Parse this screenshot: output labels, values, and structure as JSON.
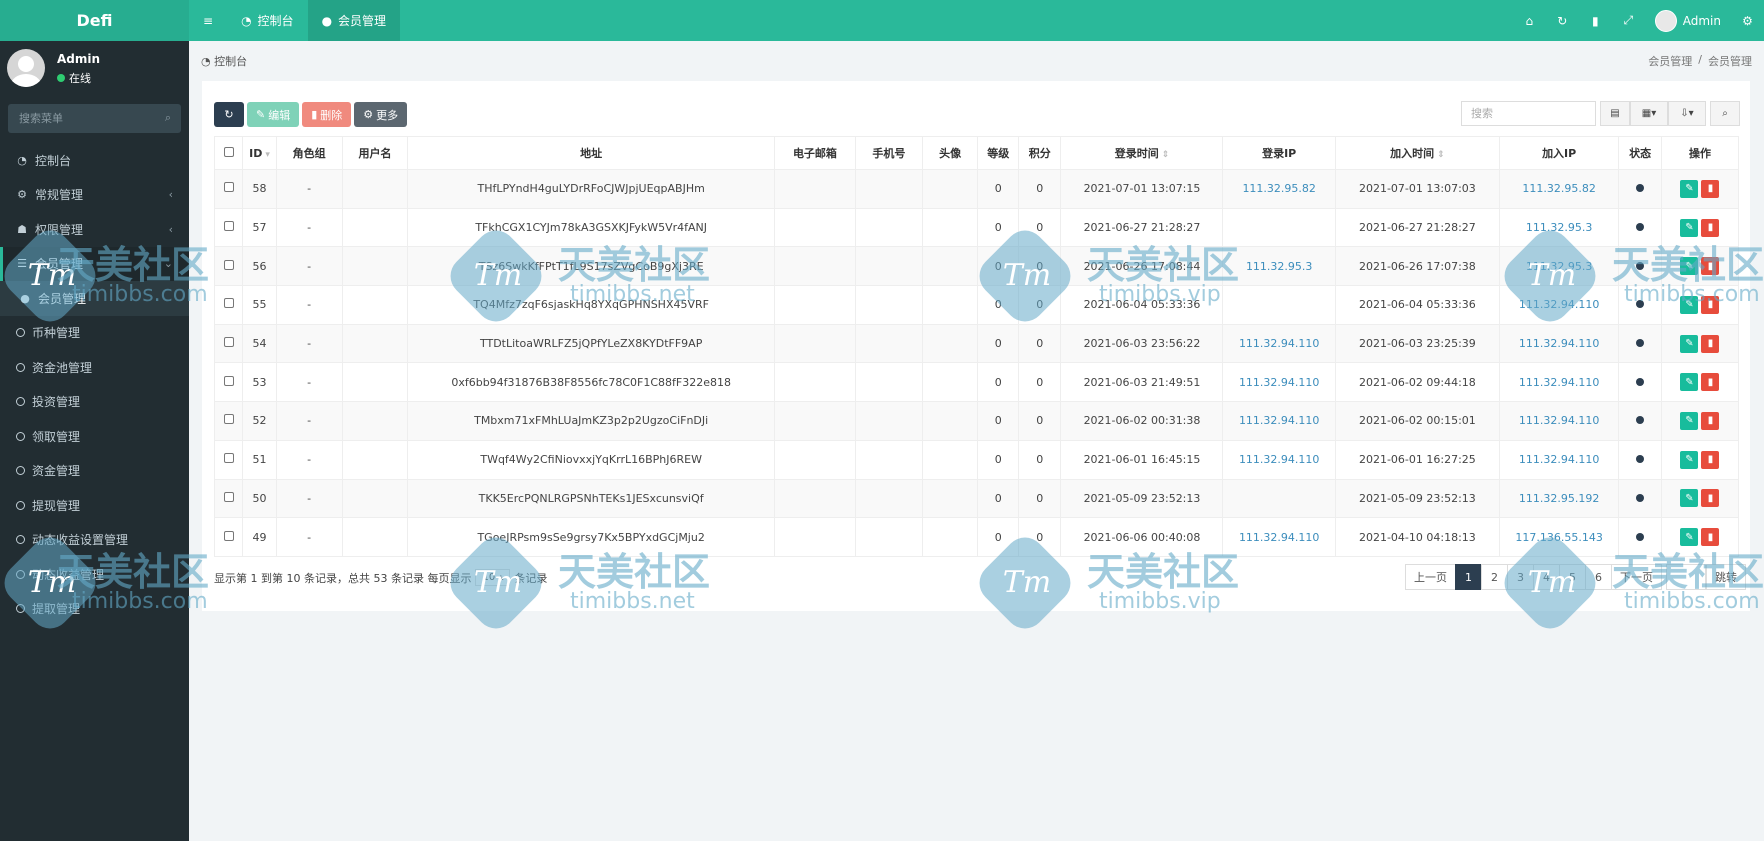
{
  "app": {
    "title": "Defi"
  },
  "topnav": {
    "tabs": [
      {
        "label": "控制台",
        "icon": "dashboard-icon"
      },
      {
        "label": "会员管理",
        "icon": "user-icon"
      }
    ],
    "user": "Admin"
  },
  "sidebar": {
    "user": {
      "name": "Admin",
      "status": "在线"
    },
    "search_placeholder": "搜索菜单",
    "items": [
      {
        "label": "控制台",
        "icon": "dashboard-icon"
      },
      {
        "label": "常规管理",
        "icon": "cogs-icon"
      },
      {
        "label": "权限管理",
        "icon": "group-icon"
      },
      {
        "label": "会员管理",
        "icon": "list-icon"
      },
      {
        "label": "会员管理",
        "icon": "user-icon"
      },
      {
        "label": "币种管理",
        "icon": "circle-icon"
      },
      {
        "label": "资金池管理",
        "icon": "circle-icon"
      },
      {
        "label": "投资管理",
        "icon": "circle-icon"
      },
      {
        "label": "领取管理",
        "icon": "circle-icon"
      },
      {
        "label": "资金管理",
        "icon": "circle-icon"
      },
      {
        "label": "提现管理",
        "icon": "circle-icon"
      },
      {
        "label": "动态收益设置管理",
        "icon": "circle-icon"
      },
      {
        "label": "动态收益管理",
        "icon": "circle-icon"
      },
      {
        "label": "提取管理",
        "icon": "circle-icon"
      }
    ]
  },
  "breadcrumb": {
    "left": "控制台",
    "right": [
      "会员管理",
      "/",
      "会员管理"
    ]
  },
  "toolbar": {
    "edit": "编辑",
    "delete": "删除",
    "more": "更多",
    "search_placeholder": "搜索"
  },
  "table": {
    "headers": [
      "ID",
      "角色组",
      "用户名",
      "地址",
      "电子邮箱",
      "手机号",
      "头像",
      "等级",
      "积分",
      "登录时间",
      "登录IP",
      "加入时间",
      "加入IP",
      "状态",
      "操作"
    ],
    "rows": [
      {
        "id": "58",
        "group": "-",
        "username": "",
        "address": "THfLPYndH4guLYDrRFoCJWJpjUEqpABJHm",
        "email": "",
        "mobile": "",
        "avatar": "",
        "level": "0",
        "score": "0",
        "logintime": "2021-07-01 13:07:15",
        "loginip": "111.32.95.82",
        "jointime": "2021-07-01 13:07:03",
        "joinip": "111.32.95.82"
      },
      {
        "id": "57",
        "group": "-",
        "username": "",
        "address": "TFkhCGX1CYJm78kA3GSXKJFykW5Vr4fANJ",
        "email": "",
        "mobile": "",
        "avatar": "",
        "level": "0",
        "score": "0",
        "logintime": "2021-06-27 21:28:27",
        "loginip": "",
        "jointime": "2021-06-27 21:28:27",
        "joinip": "111.32.95.3"
      },
      {
        "id": "56",
        "group": "-",
        "username": "",
        "address": "TSz6SwkKfFPtT1fL9S17sZVgCoB9gXj3RE",
        "email": "",
        "mobile": "",
        "avatar": "",
        "level": "0",
        "score": "0",
        "logintime": "2021-06-26 17:08:44",
        "loginip": "111.32.95.3",
        "jointime": "2021-06-26 17:07:38",
        "joinip": "111.32.95.3"
      },
      {
        "id": "55",
        "group": "-",
        "username": "",
        "address": "TQ4Mfz7zqF6sjaskHq8YXqGPHNSHX45VRF",
        "email": "",
        "mobile": "",
        "avatar": "",
        "level": "0",
        "score": "0",
        "logintime": "2021-06-04 05:33:36",
        "loginip": "",
        "jointime": "2021-06-04 05:33:36",
        "joinip": "111.32.94.110"
      },
      {
        "id": "54",
        "group": "-",
        "username": "",
        "address": "TTDtLitoaWRLFZ5jQPfYLeZX8KYDtFF9AP",
        "email": "",
        "mobile": "",
        "avatar": "",
        "level": "0",
        "score": "0",
        "logintime": "2021-06-03 23:56:22",
        "loginip": "111.32.94.110",
        "jointime": "2021-06-03 23:25:39",
        "joinip": "111.32.94.110"
      },
      {
        "id": "53",
        "group": "-",
        "username": "",
        "address": "0xf6bb94f31876B38F8556fc78C0F1C88fF322e818",
        "email": "",
        "mobile": "",
        "avatar": "",
        "level": "0",
        "score": "0",
        "logintime": "2021-06-03 21:49:51",
        "loginip": "111.32.94.110",
        "jointime": "2021-06-02 09:44:18",
        "joinip": "111.32.94.110"
      },
      {
        "id": "52",
        "group": "-",
        "username": "",
        "address": "TMbxm71xFMhLUaJmKZ3p2p2UgzoCiFnDJi",
        "email": "",
        "mobile": "",
        "avatar": "",
        "level": "0",
        "score": "0",
        "logintime": "2021-06-02 00:31:38",
        "loginip": "111.32.94.110",
        "jointime": "2021-06-02 00:15:01",
        "joinip": "111.32.94.110"
      },
      {
        "id": "51",
        "group": "-",
        "username": "",
        "address": "TWqf4Wy2CfiNiovxxjYqKrrL16BPhJ6REW",
        "email": "",
        "mobile": "",
        "avatar": "",
        "level": "0",
        "score": "0",
        "logintime": "2021-06-01 16:45:15",
        "loginip": "111.32.94.110",
        "jointime": "2021-06-01 16:27:25",
        "joinip": "111.32.94.110"
      },
      {
        "id": "50",
        "group": "-",
        "username": "",
        "address": "TKK5ErcPQNLRGPSNhTEKs1JESxcunsviQf",
        "email": "",
        "mobile": "",
        "avatar": "",
        "level": "0",
        "score": "0",
        "logintime": "2021-05-09 23:52:13",
        "loginip": "",
        "jointime": "2021-05-09 23:52:13",
        "joinip": "111.32.95.192"
      },
      {
        "id": "49",
        "group": "-",
        "username": "",
        "address": "TGoeJRPsm9sSe9grsy7Kx5BPYxdGCjMju2",
        "email": "",
        "mobile": "",
        "avatar": "",
        "level": "0",
        "score": "0",
        "logintime": "2021-06-06 00:40:08",
        "loginip": "111.32.94.110",
        "jointime": "2021-04-10 04:18:13",
        "joinip": "117.136.55.143"
      }
    ]
  },
  "footer": {
    "info_prefix": "显示第 1 到第 10 条记录，总共 53 条记录 每页显示",
    "page_size": "10",
    "info_suffix": "条记录"
  },
  "pagination": {
    "prev": "上一页",
    "pages": [
      "1",
      "2",
      "3",
      "4",
      "5",
      "6"
    ],
    "next": "下一页",
    "go": "跳转"
  },
  "watermark": {
    "logo_text": "Tm",
    "cn": "天美社区",
    "en1": "timibbs.net",
    "en2": "timibbs.vip",
    "en3": "timibbs.com"
  }
}
